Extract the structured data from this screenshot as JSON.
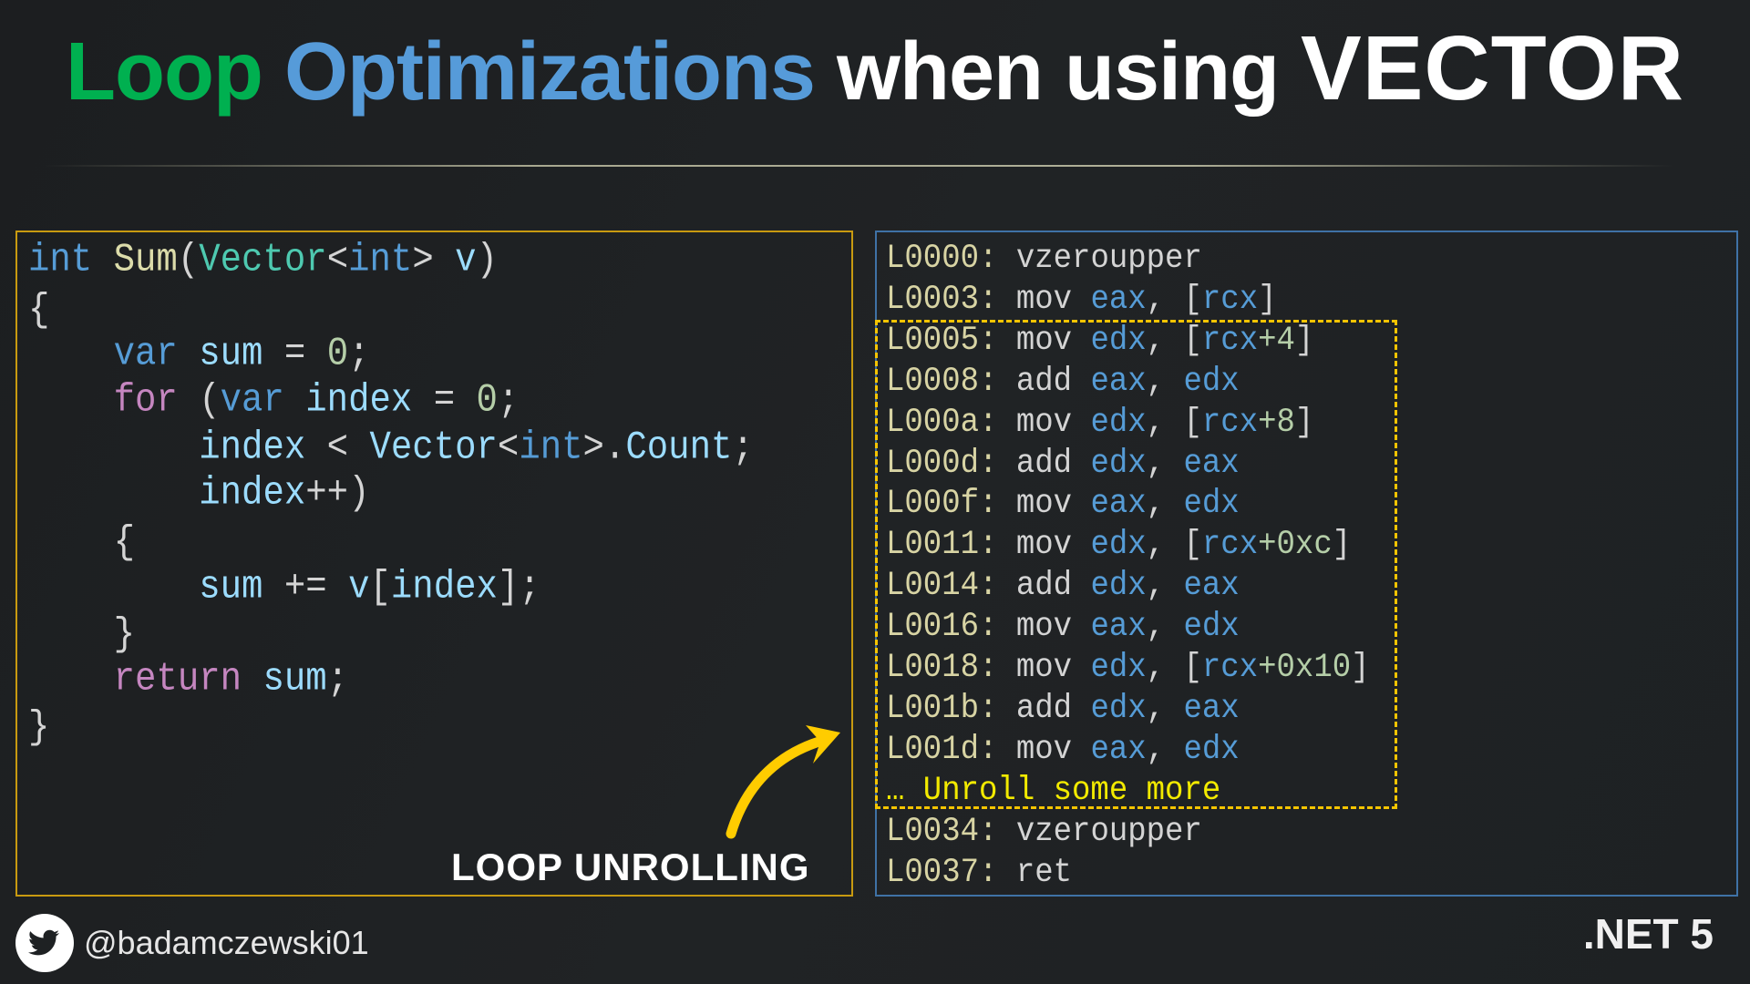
{
  "title": {
    "part1": "Loop",
    "part2": "Optimizations",
    "part3": "when using",
    "part4": "VECTOR",
    "colors": {
      "green": "#00b050",
      "blue": "#569bd9"
    }
  },
  "code": {
    "lines": [
      [
        [
          "int",
          "kw"
        ],
        [
          " ",
          "p"
        ],
        [
          "Sum",
          "fn"
        ],
        [
          "(",
          "p"
        ],
        [
          "Vector",
          "ty"
        ],
        [
          "<",
          "p"
        ],
        [
          "int",
          "kw"
        ],
        [
          "> ",
          "p"
        ],
        [
          "v",
          "id"
        ],
        [
          ")",
          "p"
        ]
      ],
      [
        [
          "{",
          "p"
        ]
      ],
      [
        [
          "    ",
          "p"
        ],
        [
          "var",
          "kw"
        ],
        [
          " ",
          "p"
        ],
        [
          "sum",
          "id"
        ],
        [
          " = ",
          "p"
        ],
        [
          "0",
          "num"
        ],
        [
          ";",
          "p"
        ]
      ],
      [
        [
          "    ",
          "p"
        ],
        [
          "for",
          "ctl"
        ],
        [
          " (",
          "p"
        ],
        [
          "var",
          "kw"
        ],
        [
          " ",
          "p"
        ],
        [
          "index",
          "id"
        ],
        [
          " = ",
          "p"
        ],
        [
          "0",
          "num"
        ],
        [
          ";",
          "p"
        ]
      ],
      [
        [
          "        ",
          "p"
        ],
        [
          "index",
          "id"
        ],
        [
          " < ",
          "p"
        ],
        [
          "Vector",
          "id"
        ],
        [
          "<",
          "p"
        ],
        [
          "int",
          "kw"
        ],
        [
          ">.",
          "p"
        ],
        [
          "Count",
          "id"
        ],
        [
          ";",
          "p"
        ]
      ],
      [
        [
          "        ",
          "p"
        ],
        [
          "index",
          "id"
        ],
        [
          "++)",
          "p"
        ]
      ],
      [
        [
          "    {",
          "p"
        ]
      ],
      [
        [
          "        ",
          "p"
        ],
        [
          "sum",
          "id"
        ],
        [
          " += ",
          "p"
        ],
        [
          "v",
          "id"
        ],
        [
          "[",
          "p"
        ],
        [
          "index",
          "id"
        ],
        [
          "];",
          "p"
        ]
      ],
      [
        [
          "    }",
          "p"
        ]
      ],
      [
        [
          "    ",
          "p"
        ],
        [
          "return",
          "ctl"
        ],
        [
          " ",
          "p"
        ],
        [
          "sum",
          "id"
        ],
        [
          ";",
          "p"
        ]
      ],
      [
        [
          "}",
          "p"
        ]
      ]
    ]
  },
  "asm": {
    "lines": [
      [
        [
          "L0000: ",
          "lbl"
        ],
        [
          "vzeroupper",
          "op"
        ]
      ],
      [
        [
          "L0003: ",
          "lbl"
        ],
        [
          "mov ",
          "op"
        ],
        [
          "eax",
          "reg"
        ],
        [
          ", [",
          "op"
        ],
        [
          "rcx",
          "reg"
        ],
        [
          "]",
          "op"
        ]
      ],
      [
        [
          "L0005: ",
          "lbl"
        ],
        [
          "mov ",
          "op"
        ],
        [
          "edx",
          "reg"
        ],
        [
          ", [",
          "op"
        ],
        [
          "rcx",
          "reg"
        ],
        [
          "+4",
          "num"
        ],
        [
          "]",
          "op"
        ]
      ],
      [
        [
          "L0008: ",
          "lbl"
        ],
        [
          "add ",
          "op"
        ],
        [
          "eax",
          "reg"
        ],
        [
          ", ",
          "op"
        ],
        [
          "edx",
          "reg"
        ]
      ],
      [
        [
          "L000a: ",
          "lbl"
        ],
        [
          "mov ",
          "op"
        ],
        [
          "edx",
          "reg"
        ],
        [
          ", [",
          "op"
        ],
        [
          "rcx",
          "reg"
        ],
        [
          "+8",
          "num"
        ],
        [
          "]",
          "op"
        ]
      ],
      [
        [
          "L000d: ",
          "lbl"
        ],
        [
          "add ",
          "op"
        ],
        [
          "edx",
          "reg"
        ],
        [
          ", ",
          "op"
        ],
        [
          "eax",
          "reg"
        ]
      ],
      [
        [
          "L000f: ",
          "lbl"
        ],
        [
          "mov ",
          "op"
        ],
        [
          "eax",
          "reg"
        ],
        [
          ", ",
          "op"
        ],
        [
          "edx",
          "reg"
        ]
      ],
      [
        [
          "L0011: ",
          "lbl"
        ],
        [
          "mov ",
          "op"
        ],
        [
          "edx",
          "reg"
        ],
        [
          ", [",
          "op"
        ],
        [
          "rcx",
          "reg"
        ],
        [
          "+0xc",
          "num"
        ],
        [
          "]",
          "op"
        ]
      ],
      [
        [
          "L0014: ",
          "lbl"
        ],
        [
          "add ",
          "op"
        ],
        [
          "edx",
          "reg"
        ],
        [
          ", ",
          "op"
        ],
        [
          "eax",
          "reg"
        ]
      ],
      [
        [
          "L0016: ",
          "lbl"
        ],
        [
          "mov ",
          "op"
        ],
        [
          "eax",
          "reg"
        ],
        [
          ", ",
          "op"
        ],
        [
          "edx",
          "reg"
        ]
      ],
      [
        [
          "L0018: ",
          "lbl"
        ],
        [
          "mov ",
          "op"
        ],
        [
          "edx",
          "reg"
        ],
        [
          ", [",
          "op"
        ],
        [
          "rcx",
          "reg"
        ],
        [
          "+0x10",
          "num"
        ],
        [
          "]",
          "op"
        ]
      ],
      [
        [
          "L001b: ",
          "lbl"
        ],
        [
          "add ",
          "op"
        ],
        [
          "edx",
          "reg"
        ],
        [
          ", ",
          "op"
        ],
        [
          "eax",
          "reg"
        ]
      ],
      [
        [
          "L001d: ",
          "lbl"
        ],
        [
          "mov ",
          "op"
        ],
        [
          "eax",
          "reg"
        ],
        [
          ", ",
          "op"
        ],
        [
          "edx",
          "reg"
        ]
      ],
      [
        [
          "… Unroll some more",
          "note"
        ]
      ],
      [
        [
          "L0034: ",
          "lbl"
        ],
        [
          "vzeroupper",
          "op"
        ]
      ],
      [
        [
          "L0037: ",
          "lbl"
        ],
        [
          "ret",
          "op"
        ]
      ]
    ]
  },
  "annotation": {
    "label": "LOOP UNROLLING",
    "arrow_color": "#ffcc00"
  },
  "footer": {
    "icon": "twitter-icon",
    "handle": "@badamczewski01",
    "badge": ".NET 5"
  }
}
